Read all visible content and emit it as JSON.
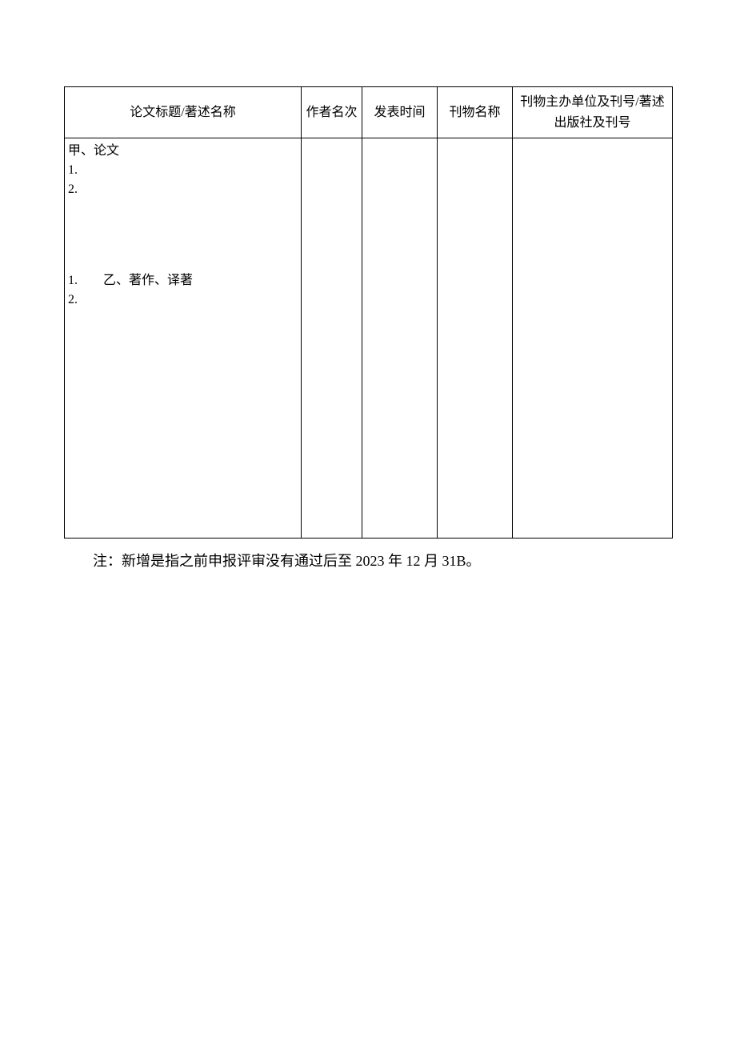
{
  "table": {
    "headers": {
      "title": "论文标题/著述名称",
      "author_rank": "作者名次",
      "publish_date": "发表时间",
      "journal_name": "刊物名称",
      "publisher": "刊物主办单位及刊号/著述出版社及刊号"
    },
    "body": {
      "section_a": {
        "heading": "甲、论文",
        "items": [
          "1.",
          "2."
        ]
      },
      "section_b": {
        "prefix": "1.",
        "heading": "乙、著作、译著",
        "items": [
          "2."
        ]
      }
    }
  },
  "note": {
    "label": "注：",
    "text": "新增是指之前申报评审没有通过后至 2023 年 12 月 31B。"
  }
}
